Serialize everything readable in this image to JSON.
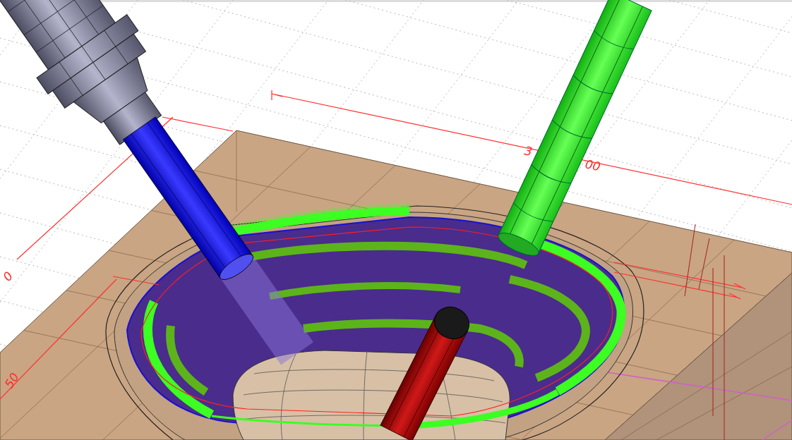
{
  "viewport": {
    "dimension_labels": [
      "3",
      "00",
      "0",
      "50"
    ]
  }
}
